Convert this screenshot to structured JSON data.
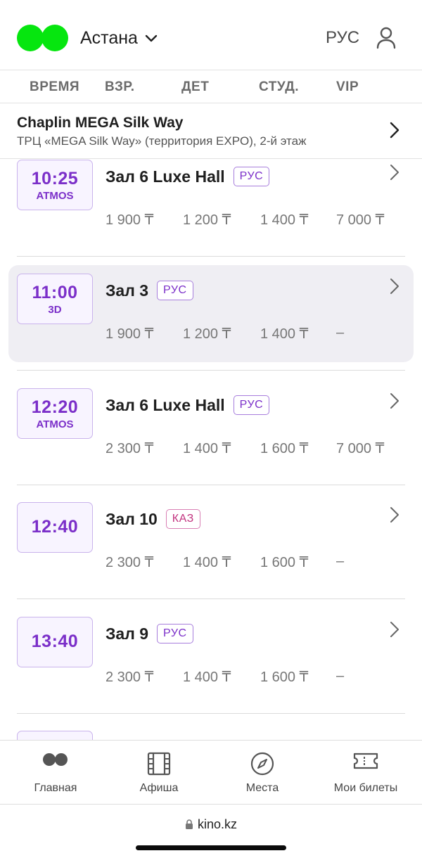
{
  "header": {
    "city": "Астана",
    "language": "РУС",
    "logo_color": "#06e60f"
  },
  "columns": {
    "time": "ВРЕМЯ",
    "adult": "ВЗР.",
    "child": "ДЕТ",
    "student": "СТУД.",
    "vip": "VIP"
  },
  "cinema": {
    "name": "Chaplin MEGA Silk Way",
    "address": "ТРЦ «MEGA Silk Way» (территория EXPO), 2-й этаж"
  },
  "sessions": [
    {
      "time": "10:25",
      "format": "ATMOS",
      "hall": "Зал 6 Luxe Hall",
      "lang": "РУС",
      "prices": [
        "1 900 ₸",
        "1 200 ₸",
        "1 400 ₸",
        "7 000 ₸"
      ]
    },
    {
      "time": "11:00",
      "format": "3D",
      "hall": "Зал 3",
      "lang": "РУС",
      "prices": [
        "1 900 ₸",
        "1 200 ₸",
        "1 400 ₸",
        "–"
      ]
    },
    {
      "time": "12:20",
      "format": "ATMOS",
      "hall": "Зал 6 Luxe Hall",
      "lang": "РУС",
      "prices": [
        "2 300 ₸",
        "1 400 ₸",
        "1 600 ₸",
        "7 000 ₸"
      ]
    },
    {
      "time": "12:40",
      "format": "",
      "hall": "Зал 10",
      "lang": "КАЗ",
      "prices": [
        "2 300 ₸",
        "1 400 ₸",
        "1 600 ₸",
        "–"
      ]
    },
    {
      "time": "13:40",
      "format": "",
      "hall": "Зал 9",
      "lang": "РУС",
      "prices": [
        "2 300 ₸",
        "1 400 ₸",
        "1 600 ₸",
        "–"
      ]
    }
  ],
  "tabs": [
    {
      "label": "Главная",
      "icon": "home-dots-icon"
    },
    {
      "label": "Афиша",
      "icon": "film-icon"
    },
    {
      "label": "Места",
      "icon": "compass-icon"
    },
    {
      "label": "Мои билеты",
      "icon": "ticket-icon"
    }
  ],
  "browser": {
    "url": "kino.kz"
  },
  "colors": {
    "accent": "#7b2fc9",
    "kaz_badge": "#c2337f",
    "active_row": "#efeef3"
  }
}
